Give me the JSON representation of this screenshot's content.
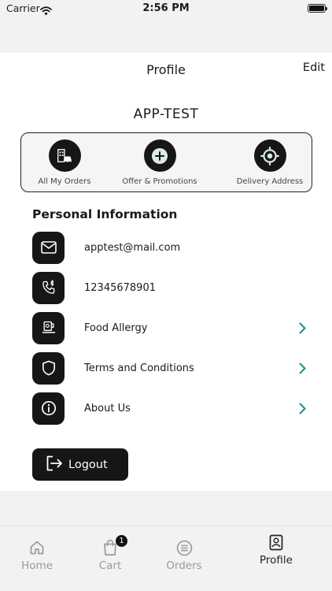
{
  "status_bar": {
    "carrier": "Carrier",
    "time": "2:56 PM"
  },
  "header": {
    "title": "Profile",
    "edit_label": "Edit"
  },
  "profile": {
    "app_name": "APP-TEST"
  },
  "quick_actions": [
    {
      "label": "All My Orders",
      "icon": "orders-icon"
    },
    {
      "label": "Offer & Promotions",
      "icon": "plus-circle-icon"
    },
    {
      "label": "Delivery Address",
      "icon": "location-target-icon"
    }
  ],
  "personal_info": {
    "title": "Personal Information",
    "rows": [
      {
        "label": "apptest@mail.com",
        "icon": "mail-icon",
        "has_chevron": false
      },
      {
        "label": "12345678901",
        "icon": "phone-icon",
        "has_chevron": false
      },
      {
        "label": "Food Allergy",
        "icon": "food-icon",
        "has_chevron": true
      },
      {
        "label": "Terms and Conditions",
        "icon": "shield-icon",
        "has_chevron": true
      },
      {
        "label": "About Us",
        "icon": "info-icon",
        "has_chevron": true
      }
    ]
  },
  "logout": {
    "label": "Logout"
  },
  "tabbar": {
    "tabs": [
      {
        "label": "Home",
        "icon": "home-icon"
      },
      {
        "label": "Cart",
        "icon": "cart-icon"
      },
      {
        "label": "Orders",
        "icon": "orders-list-icon"
      },
      {
        "label": "Profile",
        "icon": "profile-icon"
      }
    ],
    "active_tab": "Profile",
    "cart_badge": "1"
  },
  "colors": {
    "accent": "#1f8a8a",
    "dark": "#161616",
    "background": "#f2f2f2"
  }
}
